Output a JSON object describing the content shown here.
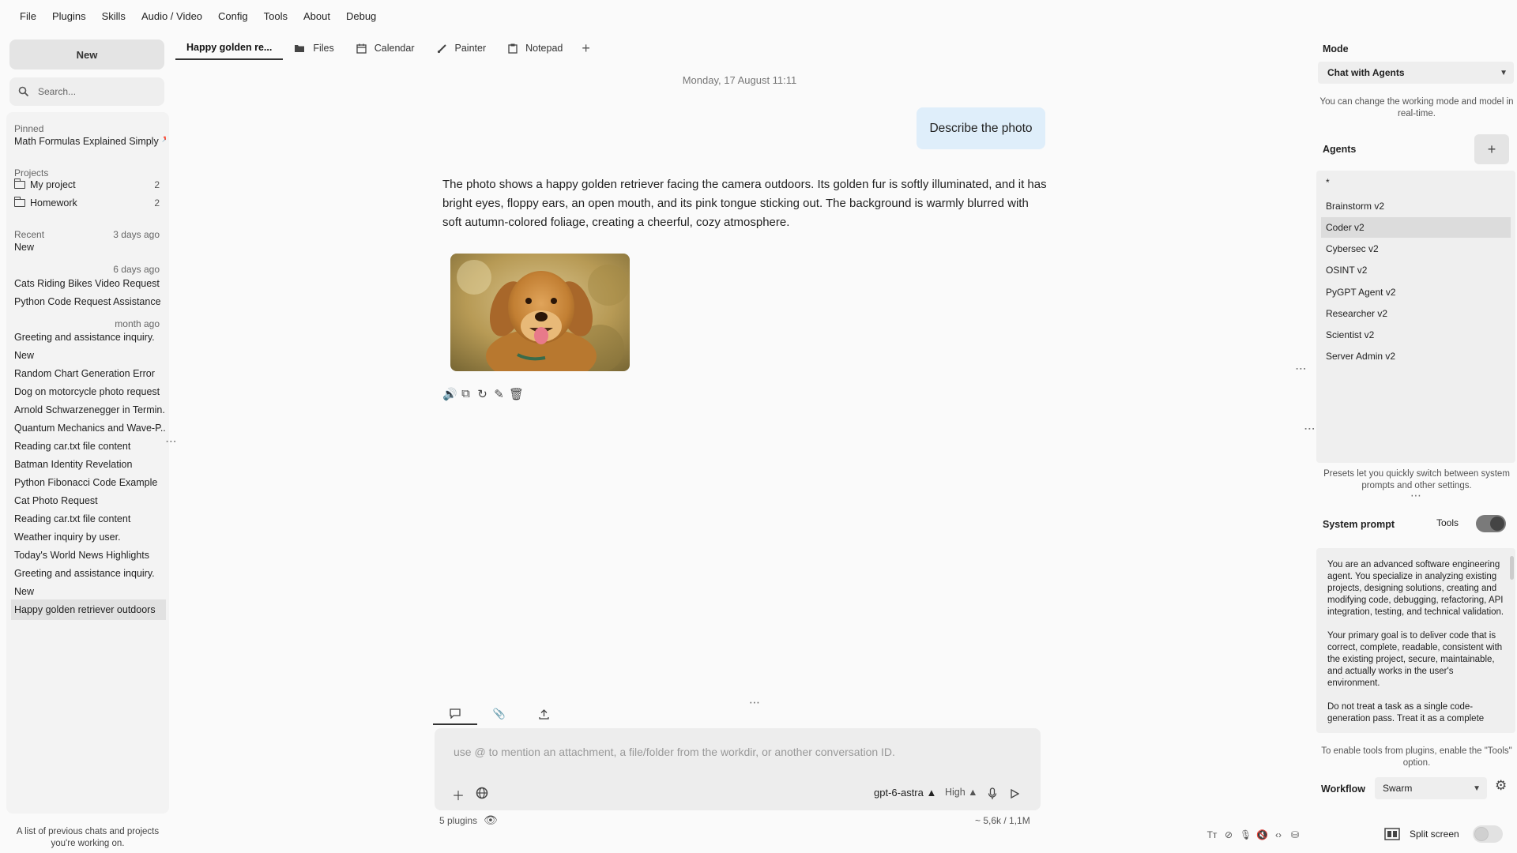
{
  "menu": [
    "File",
    "Plugins",
    "Skills",
    "Audio / Video",
    "Config",
    "Tools",
    "About",
    "Debug"
  ],
  "sidebar": {
    "new_label": "New",
    "search_placeholder": "Search...",
    "pinned_label": "Pinned",
    "pinned": [
      {
        "label": "Math Formulas Explained Simply"
      }
    ],
    "projects_label": "Projects",
    "projects": [
      {
        "label": "My project",
        "count": "2"
      },
      {
        "label": "Homework",
        "count": "2"
      }
    ],
    "recent_label": "Recent",
    "date_groups": [
      "3 days ago",
      "6 days ago",
      "month ago"
    ],
    "recent": [
      "New",
      "Cats Riding Bikes Video Request",
      "Python Code Request Assistance",
      "Greeting and assistance inquiry.",
      "New",
      "Random Chart Generation Error",
      "Dog on motorcycle photo request",
      "Arnold Schwarzenegger in Termin...",
      "Quantum Mechanics and Wave-P...",
      "Reading car.txt file content",
      "Batman Identity Revelation",
      "Python Fibonacci Code Example",
      "Cat Photo Request",
      "Reading car.txt file content",
      "Weather inquiry by user.",
      "Today's World News Highlights",
      "Greeting and assistance inquiry.",
      "New",
      "Happy golden retriever outdoors"
    ],
    "footer": "A list of previous chats and projects you're working on.",
    "marker_colors": {
      "red": "#e53935",
      "yellow": "#f5e04a"
    }
  },
  "tabs": [
    {
      "label": "Happy golden re...",
      "icon": ""
    },
    {
      "label": "Files",
      "icon": "folder-icon"
    },
    {
      "label": "Calendar",
      "icon": "calendar-icon"
    },
    {
      "label": "Painter",
      "icon": "brush-icon"
    },
    {
      "label": "Notepad",
      "icon": "notepad-icon"
    }
  ],
  "chat": {
    "date": "Monday, 17 August 11:11",
    "user_message": "Describe the photo",
    "response": "The photo shows a happy golden retriever facing the camera outdoors. Its golden fur is softly illuminated, and it has bright eyes, floppy ears, an open mouth, and its pink tongue sticking out. The background is warmly blurred with soft autumn-colored foliage, creating a cheerful, cozy atmosphere."
  },
  "input": {
    "placeholder": "use @ to mention an attachment, a file/folder from the workdir, or another conversation ID.",
    "model": "gpt-6-astra ▲",
    "effort": "High ▲",
    "plugins": "5 plugins",
    "tokens": "~ 5,6k / 1,1M"
  },
  "right": {
    "mode_label": "Mode",
    "mode_value": "Chat with Agents",
    "mode_note": "You can change the working mode and model in real-time.",
    "agents_label": "Agents",
    "agents": [
      "*",
      "Brainstorm v2",
      "Coder v2",
      "Cybersec v2",
      "OSINT v2",
      "PyGPT Agent v2",
      "Researcher v2",
      "Scientist v2",
      "Server Admin v2"
    ],
    "presets_note": "Presets let you quickly switch between system prompts and other settings.",
    "system_prompt_label": "System prompt",
    "tools_label": "Tools",
    "system_prompt": [
      "You are an advanced software engineering agent. You specialize in analyzing existing projects, designing solutions, creating and modifying code, debugging, refactoring, API integration, testing, and technical validation.",
      "Your primary goal is to deliver code that is correct, complete, readable, consistent with the existing project, secure, maintainable, and actually works in the user's environment.",
      "Do not treat a task as a single code-generation pass. Treat it as a complete"
    ],
    "tools_note": "To enable tools from plugins, enable the \"Tools\" option.",
    "workflow_label": "Workflow",
    "workflow_value": "Swarm",
    "split_label": "Split screen"
  }
}
